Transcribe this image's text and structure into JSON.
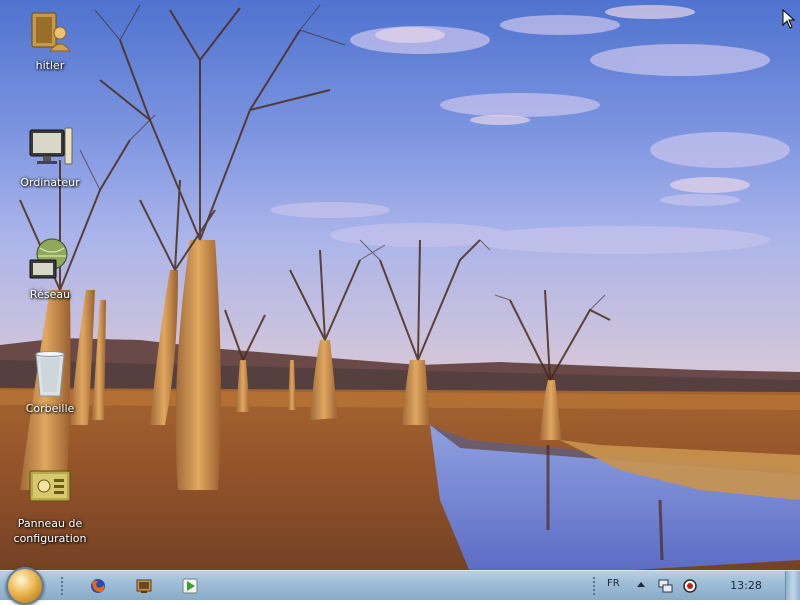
{
  "desktop": {
    "icons": [
      {
        "label": "hitler",
        "icon": "user-folder-icon"
      },
      {
        "label": "Ordinateur",
        "icon": "computer-icon"
      },
      {
        "label": "Réseau",
        "icon": "network-icon"
      },
      {
        "label": "Corbeille",
        "icon": "recycle-bin-icon"
      },
      {
        "label": "Panneau de\nconfiguration",
        "icon": "control-panel-icon"
      }
    ]
  },
  "taskbar": {
    "start": {
      "icon": "start-orb-icon"
    },
    "quick_launch": [
      {
        "icon": "firefox-icon"
      },
      {
        "icon": "show-desktop-icon"
      },
      {
        "icon": "media-player-icon"
      }
    ],
    "tray": {
      "language": "FR",
      "icons": [
        "show-hidden-icons-arrow",
        "network-status-icon",
        "volume-icon"
      ],
      "clock": "13:28"
    }
  },
  "colors": {
    "taskbar_top": "#b8d0e4",
    "taskbar_bottom": "#89abc8",
    "sky_top": "#5b7fd8",
    "ground": "#8a5530"
  }
}
